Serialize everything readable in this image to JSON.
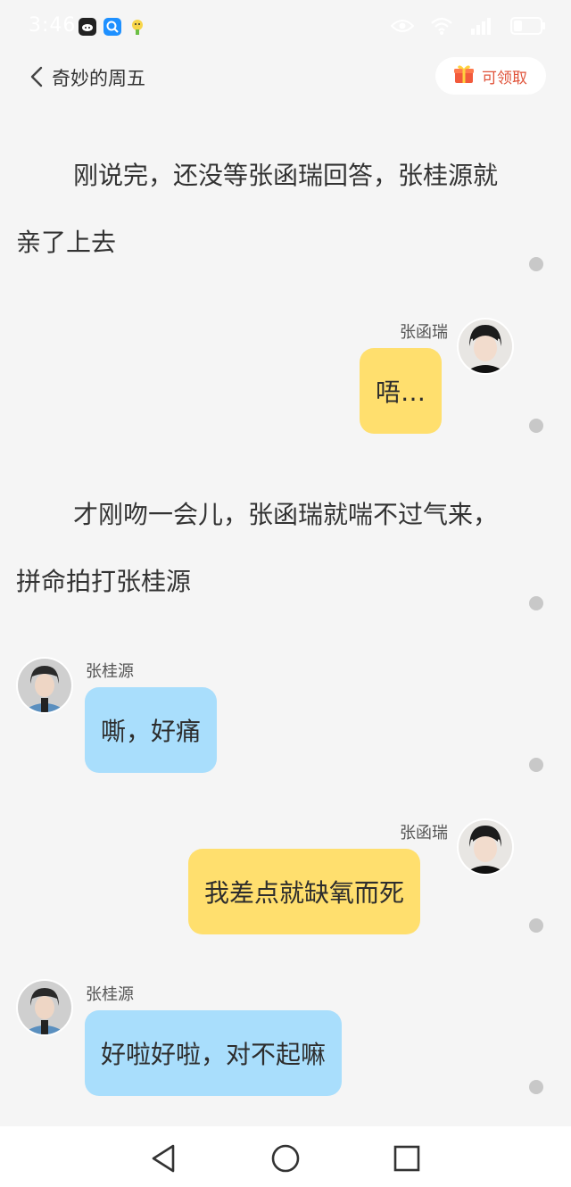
{
  "status_bar": {
    "time": "3:46",
    "icons": [
      "cat-app-icon",
      "search-app-icon",
      "mascot-app-icon",
      "eye-icon",
      "wifi-icon",
      "signal-icon",
      "battery-icon"
    ]
  },
  "header": {
    "title": "奇妙的周五",
    "claim_label": "可领取",
    "claim_color": "#e0533a"
  },
  "story": {
    "narration_1": "刚说完，还没等张函瑞回答，张桂源就亲了上去",
    "narration_2": "才刚吻一会儿，张函瑞就喘不过气来，拼命拍打张桂源",
    "messages": [
      {
        "speaker": "张函瑞",
        "text": "唔…",
        "side": "right"
      },
      {
        "speaker": "张桂源",
        "text": "嘶，好痛",
        "side": "left"
      },
      {
        "speaker": "张函瑞",
        "text": "我差点就缺氧而死",
        "side": "right"
      },
      {
        "speaker": "张桂源",
        "text": "好啦好啦，对不起嘛",
        "side": "left"
      }
    ]
  },
  "colors": {
    "background": "#f5f5f5",
    "bubble_right": "#ffdf6e",
    "bubble_left": "#a9defc"
  },
  "navigation": {
    "buttons": [
      "back-triangle-icon",
      "home-circle-icon",
      "recents-square-icon"
    ]
  }
}
